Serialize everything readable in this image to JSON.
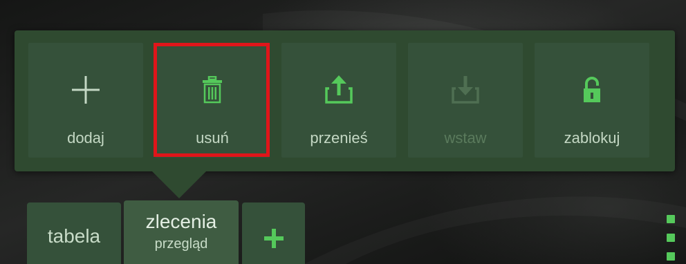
{
  "toolbar": {
    "items": [
      {
        "label": "dodaj",
        "icon": "plus-icon",
        "enabled": true
      },
      {
        "label": "usuń",
        "icon": "trash-icon",
        "enabled": true,
        "highlighted": true
      },
      {
        "label": "przenieś",
        "icon": "upload-icon",
        "enabled": true
      },
      {
        "label": "wstaw",
        "icon": "download-icon",
        "enabled": false
      },
      {
        "label": "zablokuj",
        "icon": "lock-icon",
        "enabled": true
      }
    ]
  },
  "tabs": {
    "tabela": {
      "label": "tabela"
    },
    "zlecenia": {
      "title": "zlecenia",
      "subtitle": "przegląd",
      "active": true
    },
    "add": {
      "icon": "plus-icon"
    }
  },
  "menu": {
    "icon": "more-vertical-icon"
  },
  "colors": {
    "panel": "#2f4a30",
    "tile": "#35513a",
    "accent_green": "#55c95b",
    "highlight_red": "#e0151a",
    "label_text": "#c4d8c4",
    "disabled_text": "#5a7a5c"
  }
}
